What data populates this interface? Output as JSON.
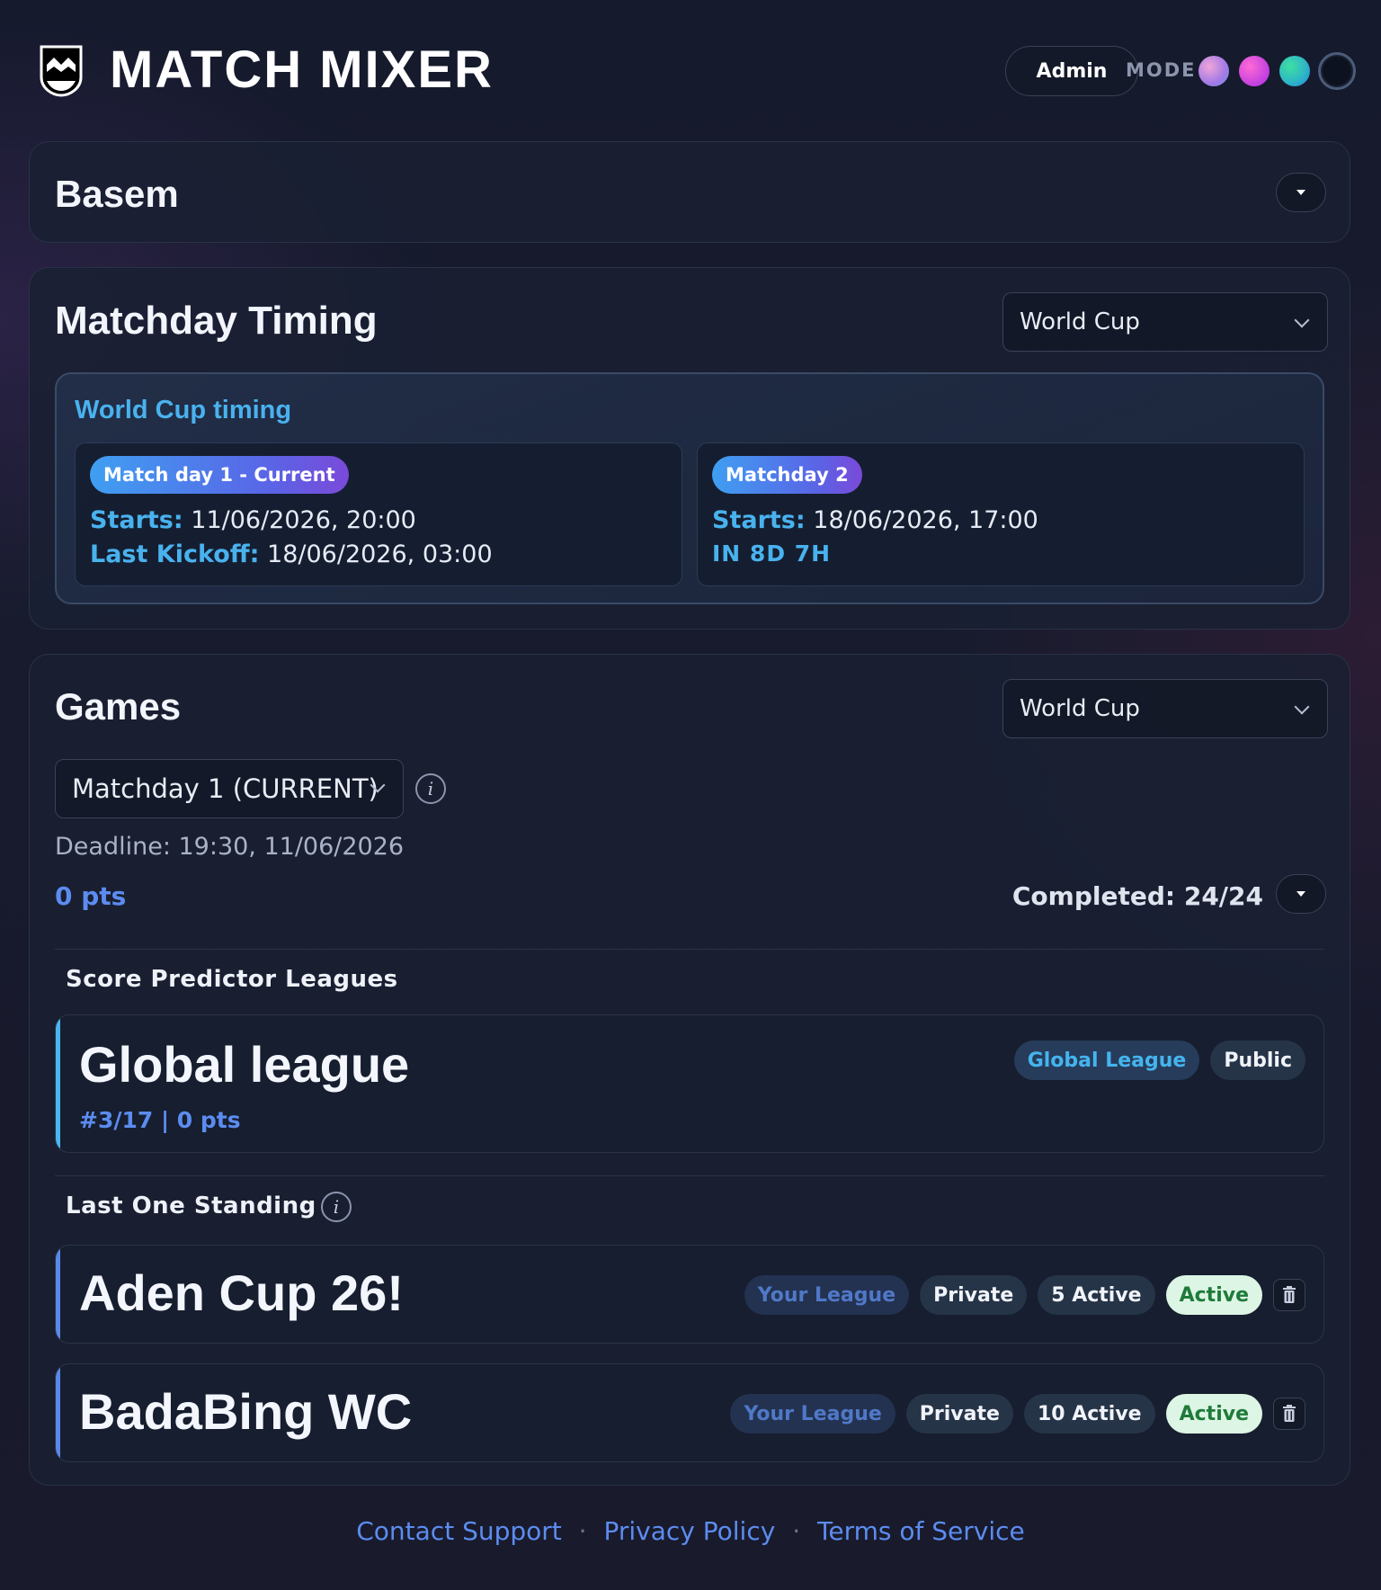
{
  "header": {
    "brand": "MATCH MIXER",
    "admin_label": "Admin",
    "mode_label": "MODE",
    "mode_swatches": [
      {
        "name": "pink-blue",
        "color": "#c08ee0"
      },
      {
        "name": "magenta",
        "color": "#e04fd9"
      },
      {
        "name": "green-teal",
        "color": "#2db3c9"
      },
      {
        "name": "dark",
        "color": "#0d1220"
      }
    ]
  },
  "profile": {
    "name": "Basem"
  },
  "timing": {
    "title": "Matchday Timing",
    "competition": "World Cup",
    "panel_title": "World Cup timing",
    "matchdays": [
      {
        "pill": "Match day 1 - Current",
        "starts_key": "Starts:",
        "starts_value": "11/06/2026, 20:00",
        "last_kickoff_key": "Last Kickoff:",
        "last_kickoff_value": "18/06/2026, 03:00"
      },
      {
        "pill": "Matchday 2",
        "starts_key": "Starts:",
        "starts_value": "18/06/2026, 17:00",
        "countdown": "IN 8D 7H"
      }
    ]
  },
  "games": {
    "title": "Games",
    "competition": "World Cup",
    "matchday_select": "Matchday 1 (CURRENT)",
    "info_glyph": "i",
    "deadline": "Deadline: 19:30, 11/06/2026",
    "points": "0 pts",
    "completed": "Completed: 24/24",
    "score_predictor": {
      "label": "Score Predictor Leagues",
      "leagues": [
        {
          "name": "Global league",
          "sub": "#3/17 | 0 pts",
          "tags": [
            "Global League",
            "Public"
          ]
        }
      ]
    },
    "last_one_standing": {
      "label": "Last One Standing",
      "leagues": [
        {
          "name": "Aden Cup 26!",
          "tag_your": "Your League",
          "tag_private": "Private",
          "tag_count": "5 Active",
          "tag_status": "Active"
        },
        {
          "name": "BadaBing WC",
          "tag_your": "Your League",
          "tag_private": "Private",
          "tag_count": "10 Active",
          "tag_status": "Active"
        }
      ]
    }
  },
  "footer": {
    "links": [
      "Contact Support",
      "Privacy Policy",
      "Terms of Service"
    ],
    "separator": "·"
  }
}
